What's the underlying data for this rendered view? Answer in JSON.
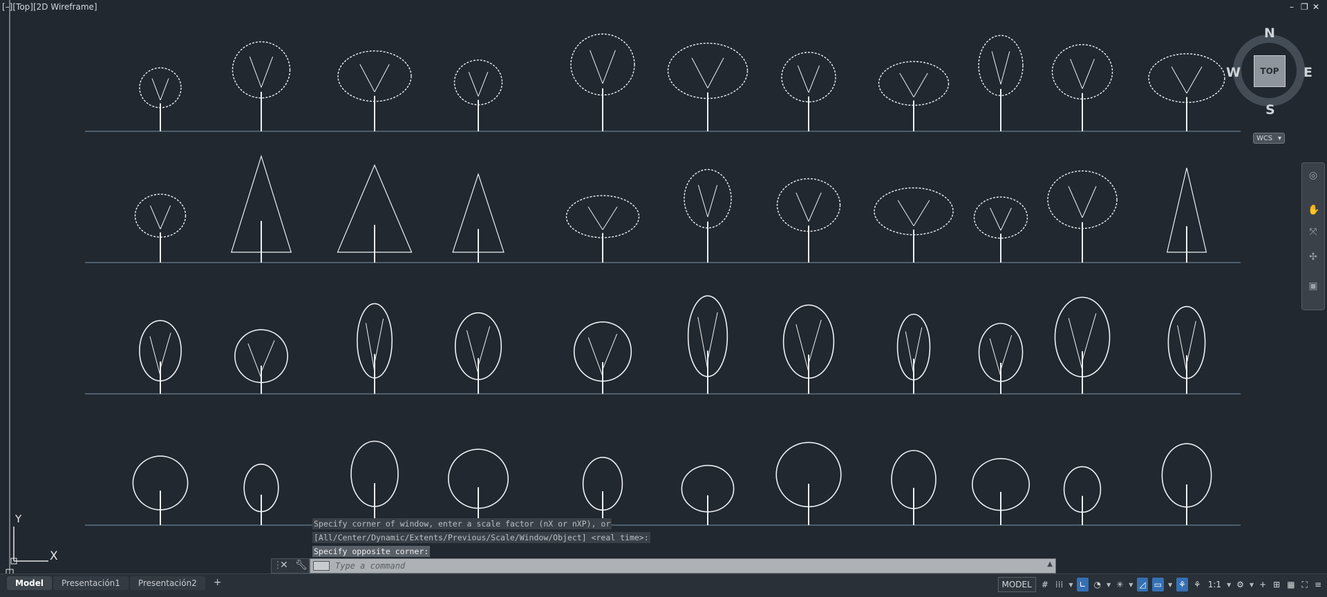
{
  "viewport": {
    "label": "[–][Top][2D Wireframe]",
    "window_controls": [
      "–",
      "❐",
      "✕"
    ]
  },
  "viewcube": {
    "north": "N",
    "south": "S",
    "west": "W",
    "east": "E",
    "face": "TOP",
    "wcs": "WCS"
  },
  "ucs": {
    "y": "Y",
    "x": "X"
  },
  "command_line": {
    "history": [
      "Specify corner of window, enter a scale factor (nX or nXP), or",
      "[All/Center/Dynamic/Extents/Previous/Scale/Window/Object] <real time>:",
      "Specify opposite corner:"
    ],
    "placeholder": "Type a command"
  },
  "layout_tabs": [
    "Model",
    "Presentación1",
    "Presentación2"
  ],
  "add_tab": "+",
  "status_bar": {
    "model_label": "MODEL",
    "annotation_scale": "1:1",
    "icons": [
      "grid-icon",
      "snap-icon",
      "ortho-icon",
      "polar-icon",
      "osnap-icon",
      "otrack-icon",
      "lineweight-icon",
      "selection-cycling-icon",
      "annotation-visibility-icon",
      "autoscale-icon",
      "workspace-gear-icon",
      "add-icon",
      "isolate-icon",
      "hardware-accel-icon",
      "clean-screen-icon",
      "customize-menu-icon"
    ]
  },
  "colors": {
    "canvas": "#212830",
    "ground_line": "#5d6f80",
    "accent_blue": "#3570b5"
  }
}
